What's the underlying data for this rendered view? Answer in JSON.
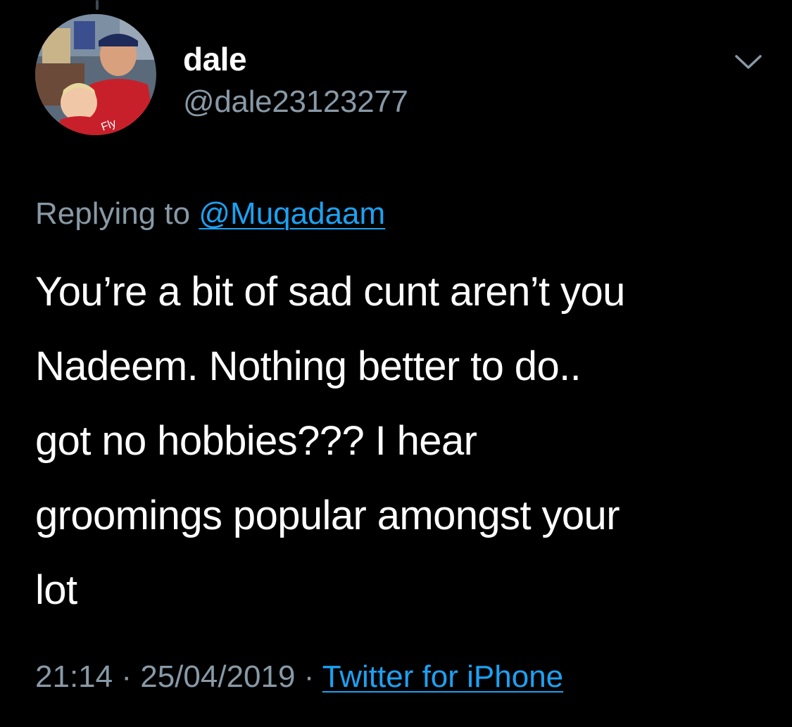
{
  "tweet": {
    "author": {
      "display_name": "dale",
      "handle": "@dale23123277",
      "avatar_icon": "profile-photo"
    },
    "menu_icon": "chevron-down-icon",
    "reply": {
      "prefix": "Replying to",
      "mention": "@Muqadaam"
    },
    "text_lines": [
      "You’re a bit of sad cunt aren’t you",
      "Nadeem. Nothing better to do..",
      "got no hobbies??? I hear",
      "groomings popular amongst your",
      "lot"
    ],
    "meta": {
      "time": "21:14",
      "separator": "·",
      "date": "25/04/2019",
      "source": "Twitter for iPhone"
    }
  },
  "colors": {
    "background": "#000000",
    "primary_text": "#ffffff",
    "secondary_text": "#8899a6",
    "link": "#1da1f2"
  }
}
